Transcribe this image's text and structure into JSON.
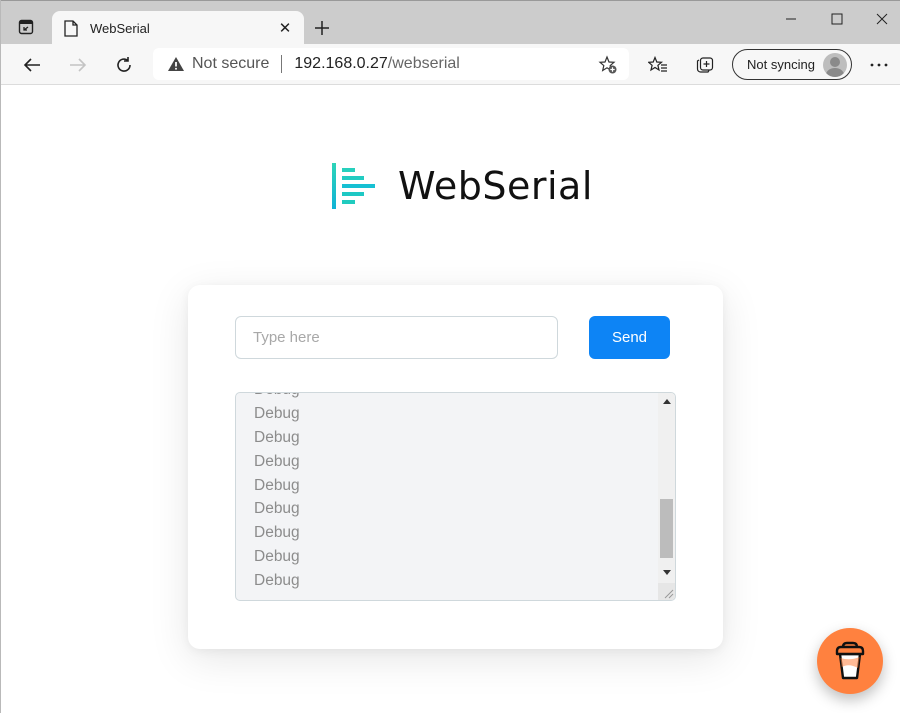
{
  "browser": {
    "tab": {
      "title": "WebSerial",
      "icon": "page-icon"
    },
    "icons": {
      "tab_actions": "tab-actions-icon",
      "close_tab": "close-icon",
      "new_tab": "plus-icon",
      "minimize": "minimize-icon",
      "maximize": "maximize-icon",
      "close_window": "close-icon",
      "back": "arrow-left-icon",
      "forward": "arrow-right-icon",
      "refresh": "refresh-icon",
      "warning": "warning-icon",
      "add_favorite": "star-plus-icon",
      "favorites": "favorites-icon",
      "collections": "collections-icon",
      "more": "ellipsis-icon"
    },
    "tab_close_glyph": "✕",
    "address": {
      "security_label": "Not secure",
      "host": "192.168.0.27",
      "path": "/webserial"
    },
    "profile": {
      "label": "Not syncing"
    }
  },
  "page": {
    "logo_text": "WebSerial",
    "brand_color": "#19c6c6",
    "input": {
      "placeholder": "Type here",
      "value": ""
    },
    "send_label": "Send",
    "send_color": "#0d84f5",
    "log_lines": [
      "Debug",
      "Debug",
      "Debug",
      "Debug",
      "Debug",
      "Debug",
      "Debug",
      "Debug",
      "Debug"
    ],
    "log_scroll_fraction": 0.85,
    "support_button": {
      "icon": "coffee-cup-icon",
      "color": "#ff813f"
    }
  }
}
